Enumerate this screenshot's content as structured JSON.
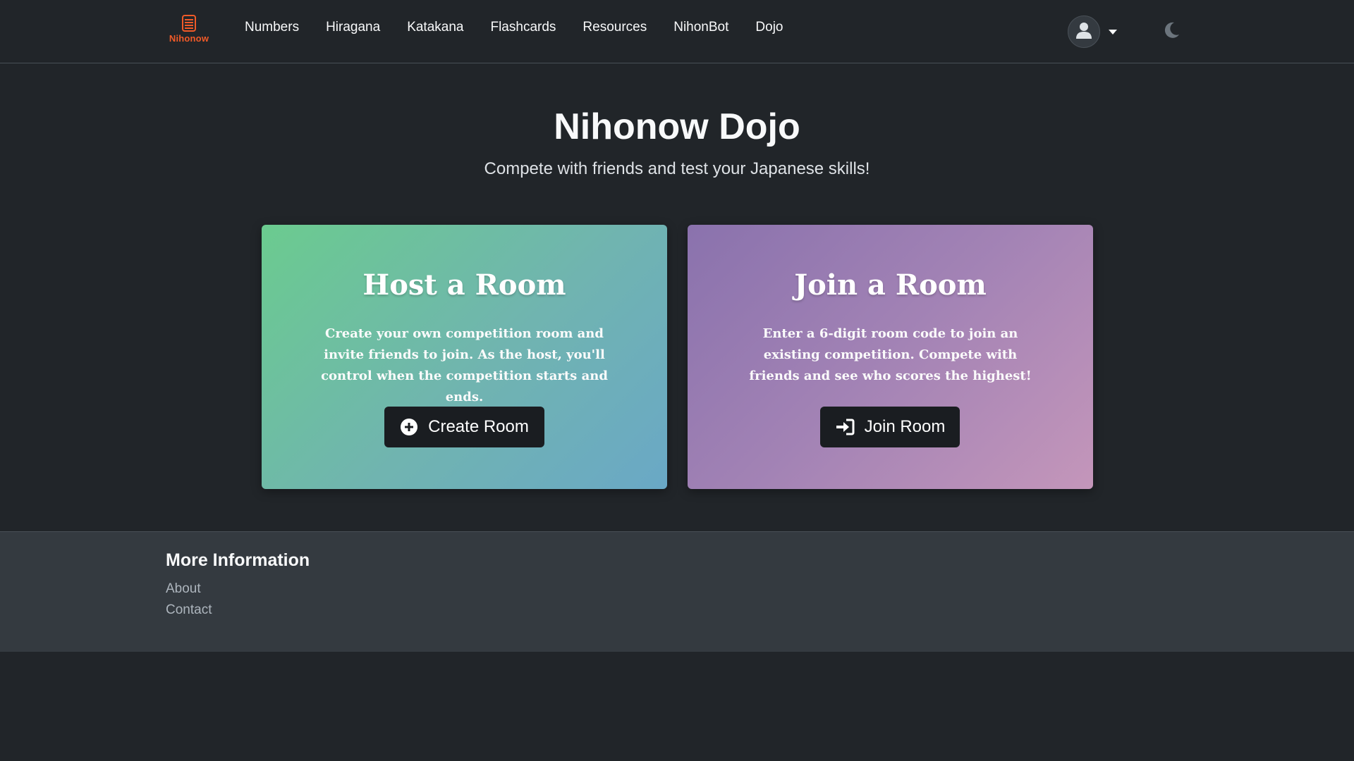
{
  "brand": {
    "name": "Nihonow",
    "logo_icon": "stacked-scroll-logo",
    "color": "#f05a28"
  },
  "nav": {
    "items": [
      {
        "label": "Numbers"
      },
      {
        "label": "Hiragana"
      },
      {
        "label": "Katakana"
      },
      {
        "label": "Flashcards"
      },
      {
        "label": "Resources"
      },
      {
        "label": "NihonBot"
      },
      {
        "label": "Dojo"
      }
    ],
    "user_icon": "user-icon",
    "dropdown_icon": "caret-down-icon",
    "theme_icon": "moon-icon"
  },
  "hero": {
    "title": "Nihonow Dojo",
    "subtitle": "Compete with friends and test your Japanese skills!"
  },
  "cards": {
    "host": {
      "title": "Host a Room",
      "description": "Create your own competition room and invite friends to join. As the host, you'll control when the competition starts and ends.",
      "button_label": "Create Room",
      "button_icon": "plus-circle-icon",
      "gradient": [
        "#6bcb8f",
        "#6aa8c6"
      ]
    },
    "join": {
      "title": "Join a Room",
      "description": "Enter a 6-digit room code to join an existing competition. Compete with friends and see who scores the highest!",
      "button_label": "Join Room",
      "button_icon": "sign-in-icon",
      "gradient": [
        "#8a72ad",
        "#c496ba"
      ]
    }
  },
  "footer": {
    "title": "More Information",
    "links": [
      {
        "label": "About"
      },
      {
        "label": "Contact"
      }
    ]
  },
  "colors": {
    "background": "#212529",
    "footer_background": "#343a40",
    "button_background": "#1a1d21"
  }
}
